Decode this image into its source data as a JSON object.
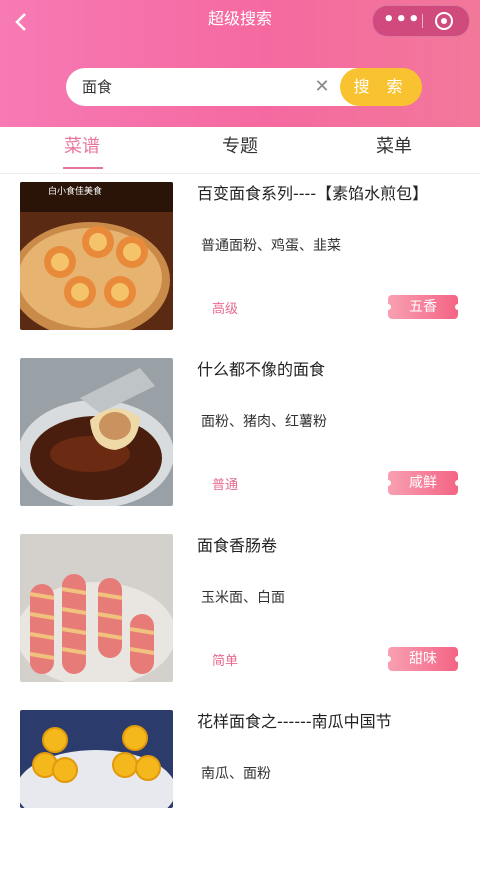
{
  "nav": {
    "title": "超级搜索",
    "back_icon": "chevron-left-icon",
    "menu_icon": "more-dots-icon",
    "close_icon": "target-circle-icon",
    "dots": "•••"
  },
  "search": {
    "value": "面食",
    "clear_icon": "close-icon",
    "clear_glyph": "✕",
    "button_label": "搜 索"
  },
  "colors": {
    "header": "#f569a0",
    "accent": "#e8769b",
    "button": "#f9c230"
  },
  "tabs": [
    {
      "label": "菜谱",
      "active": true
    },
    {
      "label": "专题",
      "active": false
    },
    {
      "label": "菜单",
      "active": false
    }
  ],
  "recipes": [
    {
      "title": "百变面食系列----【素馅水煎包】",
      "ingredients": "普通面粉、鸡蛋、韭菜",
      "level": "高级",
      "tag": "五香",
      "image_caption": "白小食佳美食"
    },
    {
      "title": "什么都不像的面食",
      "ingredients": "面粉、猪肉、红薯粉",
      "level": "普通",
      "tag": "咸鲜",
      "image_caption": ""
    },
    {
      "title": "面食香肠卷",
      "ingredients": "玉米面、白面",
      "level": "简单",
      "tag": "甜味",
      "image_caption": ""
    },
    {
      "title": "花样面食之------南瓜中国节",
      "ingredients": "南瓜、面粉",
      "level": "",
      "tag": "",
      "image_caption": ""
    }
  ]
}
